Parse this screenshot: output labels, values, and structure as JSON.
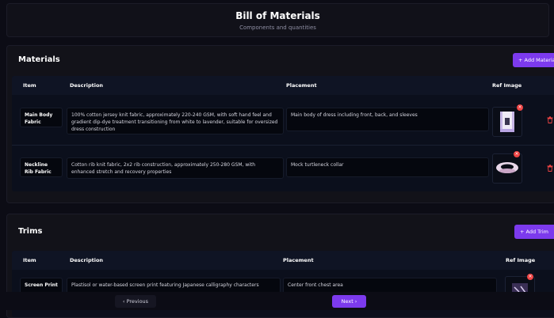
{
  "header": {
    "title": "Bill of Materials",
    "subtitle": "Components and quantities"
  },
  "materials": {
    "title": "Materials",
    "add_label": "+ Add Material",
    "columns": {
      "item": "Item",
      "description": "Description",
      "placement": "Placement",
      "ref_image": "Ref Image"
    },
    "rows": [
      {
        "item": "Main Body Fabric",
        "description": "100% cotton jersey knit fabric, approximately 220-240 GSM, with soft hand feel and gradient dip-dye treatment transitioning from white to lavender, suitable for oversized dress construction",
        "placement": "Main body of dress including front, back, and sleeves"
      },
      {
        "item": "Neckline Rib Fabric",
        "description": "Cotton rib knit fabric, 2x2 rib construction, approximately 250-280 GSM, with enhanced stretch and recovery properties",
        "placement": "Mock turtleneck collar"
      }
    ]
  },
  "trims": {
    "title": "Trims",
    "add_label": "+ Add Trim",
    "columns": {
      "item": "Item",
      "description": "Description",
      "placement": "Placement",
      "ref_image": "Ref Image"
    },
    "rows": [
      {
        "item": "Screen Print",
        "description": "Plastisol or water-based screen print featuring Japanese calligraphy characters",
        "placement": "Center front chest area"
      }
    ]
  },
  "footer": {
    "previous_label": "‹   Previous",
    "next_label": "Next   ›"
  },
  "icons": {
    "remove": "close-icon",
    "delete": "trash-icon"
  },
  "colors": {
    "accent": "#7c3aed",
    "danger": "#ef4444",
    "background": "#0c0c15"
  }
}
